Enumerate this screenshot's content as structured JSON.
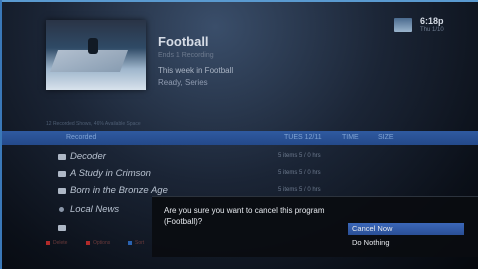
{
  "program": {
    "title": "Football",
    "subtitle": "Ends 1 Recording",
    "line2": "This week in Football",
    "line3": "Ready, Series"
  },
  "clock": {
    "time": "6:18p",
    "date": "Thu 1/10"
  },
  "list": {
    "caption": "12 Recorded Shows, 46% Available Space",
    "headers": {
      "name": "Recorded",
      "date": "TUES 12/11",
      "time": "TIME",
      "size": "SIZE"
    },
    "rows": [
      {
        "name": "Decoder",
        "when": "5 items 5 / 0 hrs"
      },
      {
        "name": "A Study in Crimson",
        "when": "5 items 5 / 0 hrs"
      },
      {
        "name": "Born in the Bronze Age",
        "when": "5 items 5 / 0 hrs"
      },
      {
        "name": "Local News",
        "when": ""
      },
      {
        "name": "",
        "when": ""
      }
    ]
  },
  "legend": [
    {
      "label": "Delete",
      "color": "#b02a2a"
    },
    {
      "label": "Options",
      "color": "#b02a2a"
    },
    {
      "label": "Sort",
      "color": "#2a62b0"
    }
  ],
  "dialog": {
    "message": "Are you sure you want to cancel this program (Football)?",
    "options": [
      "Cancel Now",
      "Do Nothing"
    ]
  }
}
